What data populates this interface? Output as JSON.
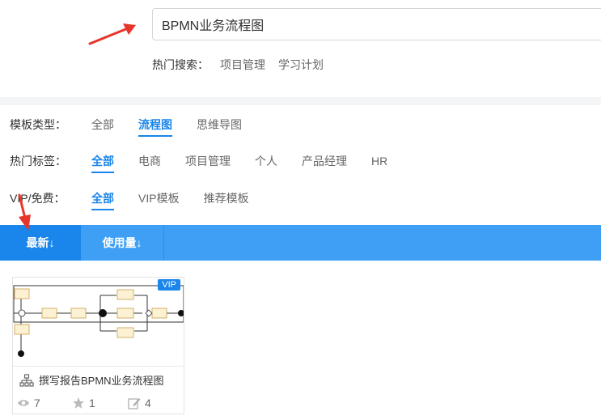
{
  "search": {
    "value": "BPMN业务流程图",
    "hot_label": "热门搜索：",
    "hot_items": [
      "项目管理",
      "学习计划"
    ]
  },
  "filters": {
    "template_type": {
      "label": "模板类型：",
      "options": [
        "全部",
        "流程图",
        "思维导图"
      ],
      "active": "流程图"
    },
    "hot_tags": {
      "label": "热门标签：",
      "options": [
        "全部",
        "电商",
        "项目管理",
        "个人",
        "产品经理",
        "HR"
      ],
      "active": "全部"
    },
    "vip": {
      "label": "VIP/免费：",
      "options": [
        "全部",
        "VIP模板",
        "推荐模板"
      ],
      "active": "全部"
    }
  },
  "sort": {
    "tabs": [
      "最新↓",
      "使用量↓"
    ],
    "active": "最新↓"
  },
  "cards": [
    {
      "title": "撰写报告BPMN业务流程图",
      "badge": "VIP",
      "views": "7",
      "stars": "1",
      "edits": "4"
    }
  ],
  "colors": {
    "accent": "#1a85ea",
    "sort_bar": "#3f9ff4",
    "annotation_arrow": "#e8352b"
  },
  "icons": {
    "card_title": "org-chart-icon",
    "views": "eye-icon",
    "stars": "star-icon",
    "edits": "edit-icon"
  }
}
